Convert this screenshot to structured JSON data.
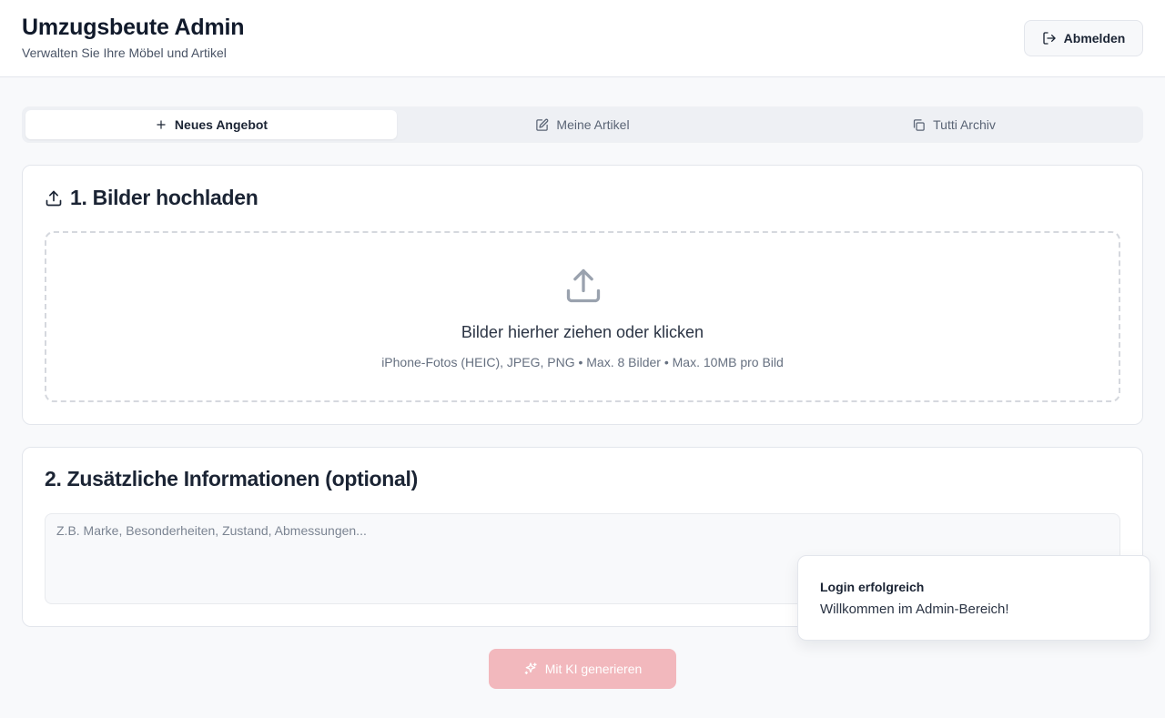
{
  "header": {
    "title": "Umzugsbeute Admin",
    "subtitle": "Verwalten Sie Ihre Möbel und Artikel",
    "logout_label": "Abmelden"
  },
  "tabs": [
    {
      "label": "Neues Angebot",
      "icon": "plus-icon",
      "active": true
    },
    {
      "label": "Meine Artikel",
      "icon": "edit-icon",
      "active": false
    },
    {
      "label": "Tutti Archiv",
      "icon": "copy-icon",
      "active": false
    }
  ],
  "upload": {
    "title": "1. Bilder hochladen",
    "dropzone_title": "Bilder hierher ziehen oder klicken",
    "dropzone_hint": "iPhone-Fotos (HEIC), JPEG, PNG • Max. 8 Bilder • Max. 10MB pro Bild"
  },
  "info": {
    "title": "2. Zusätzliche Informationen (optional)",
    "placeholder": "Z.B. Marke, Besonderheiten, Zustand, Abmessungen..."
  },
  "generate": {
    "label": "Mit KI generieren",
    "icon": "sparkles-icon",
    "color": "#f2b8bd"
  },
  "toast": {
    "title": "Login erfolgreich",
    "message": "Willkommen im Admin-Bereich!"
  }
}
